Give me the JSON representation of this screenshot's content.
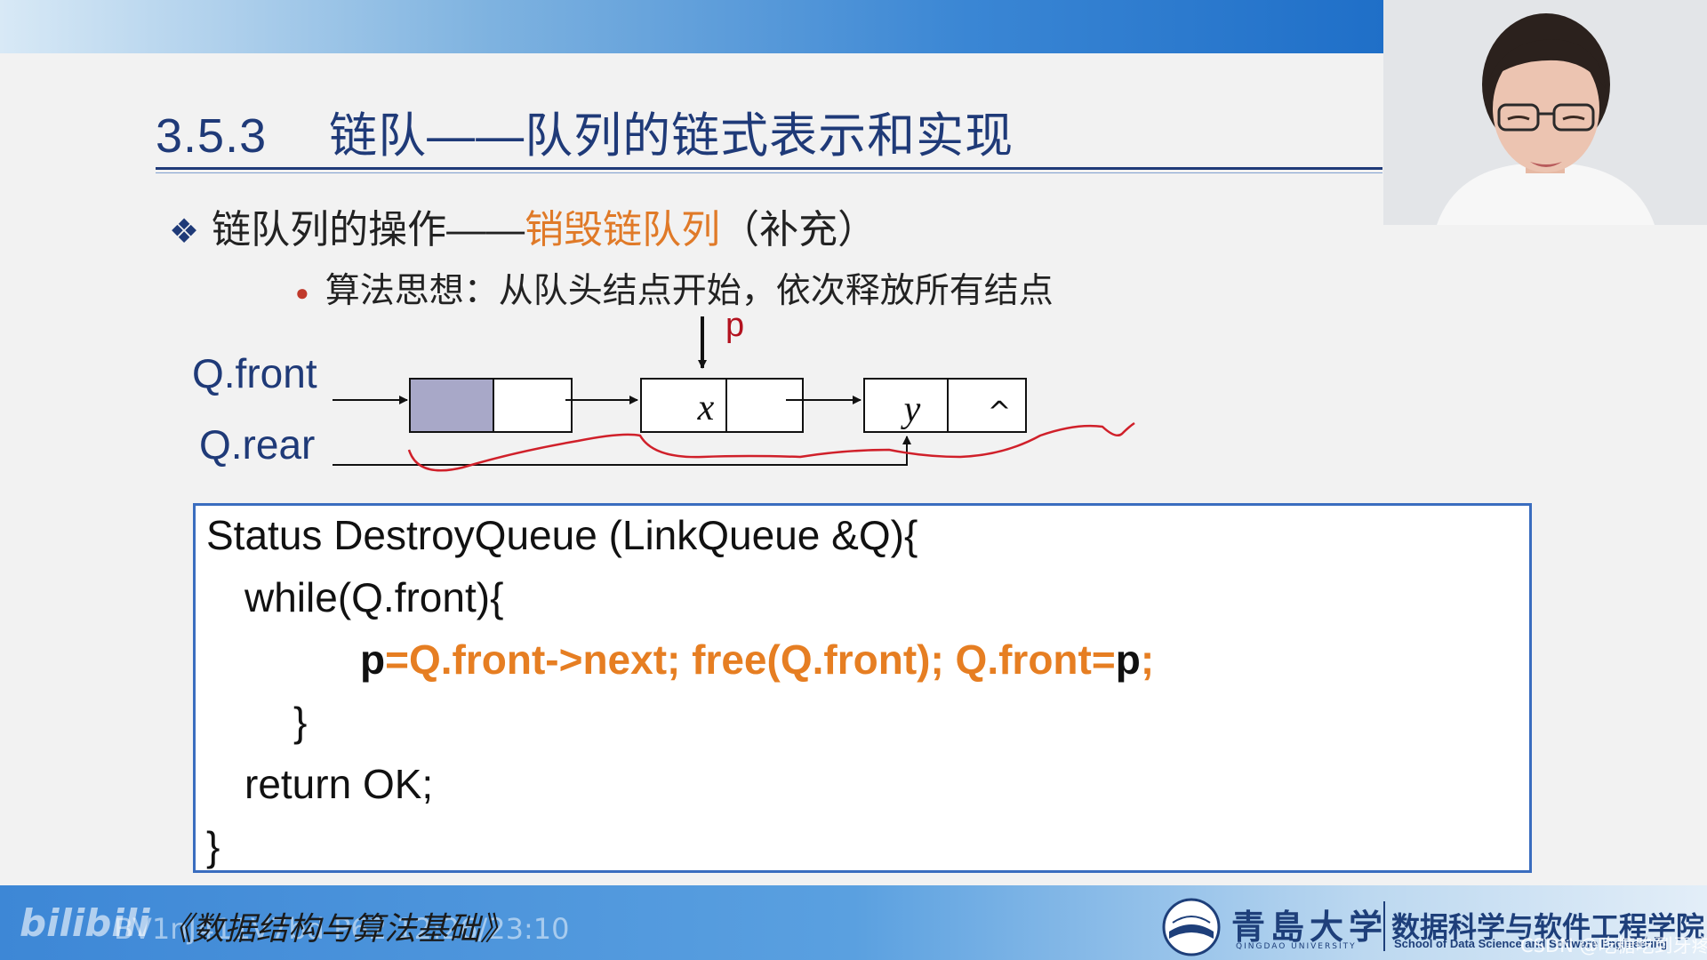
{
  "slide": {
    "section_number": "3.5.3",
    "title": "链队——队列的链式表示和实现",
    "bullet1_prefix": "链队列的操作——",
    "bullet1_highlight": "销毁链队列",
    "bullet1_suffix": "（补充）",
    "bullet2": "算法思想：从队头结点开始，依次释放所有结点"
  },
  "diagram": {
    "pointer_label": "p",
    "front_label": "Q.front",
    "rear_label": "Q.rear",
    "node_x_value": "x",
    "node_y_value": "y",
    "null_symbol": "^"
  },
  "code": {
    "line1": "Status DestroyQueue (LinkQueue &Q){",
    "line2": "while(Q.front){",
    "line3_p1": "p",
    "line3_mid": "=Q.front->next;  free(Q.front);  Q.front=",
    "line3_p2": "p",
    "line3_end": ";",
    "line4": "}",
    "line5": "return OK;",
    "line6": "}"
  },
  "footer": {
    "bili_logo": "bilibili",
    "video_id": "BV1nJ411V7bd P62 12:26/23:10",
    "course_name": "《数据结构与算法基础》",
    "university_cn": "青島大学",
    "university_en": "QINGDAO UNIVERSITY",
    "school_cn": "数据科学与软件工程学院",
    "school_en": "School of Data Science and Software Engineering",
    "watermark": "CSDN @吃糖吃到牙疼"
  },
  "colors": {
    "title_blue": "#1f3a78",
    "highlight_orange": "#e07a28",
    "code_orange": "#e67e22",
    "annotation_red": "#d0202a",
    "box_border": "#3a6dbf",
    "head_node_fill": "#a8a8c8"
  }
}
